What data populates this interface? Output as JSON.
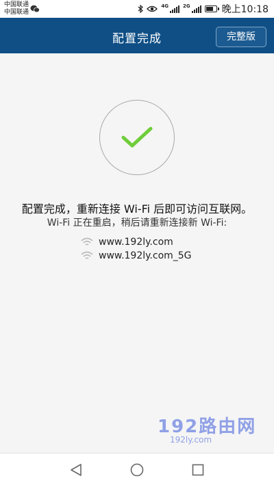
{
  "status_bar": {
    "carrier_1": "中国联通",
    "carrier_2": "中国联通",
    "network_1": "4G",
    "network_2": "2G",
    "battery_level": 0.8,
    "time": "晚上10:18"
  },
  "header": {
    "title": "配置完成",
    "full_version_label": "完整版"
  },
  "main": {
    "headline": "配置完成，重新连接 Wi-Fi 后即可访问互联网。",
    "subline": "Wi-Fi 正在重启，稍后请重新连接新 Wi-Fi:",
    "networks": [
      "www.192ly.com",
      "www.192ly.com_5G"
    ]
  },
  "watermark": {
    "title": "192路由网",
    "url": "192ly.com"
  },
  "colors": {
    "header_bg": "#0f4f86",
    "check": "#6fcd3a",
    "watermark": "#8fa0e6"
  }
}
